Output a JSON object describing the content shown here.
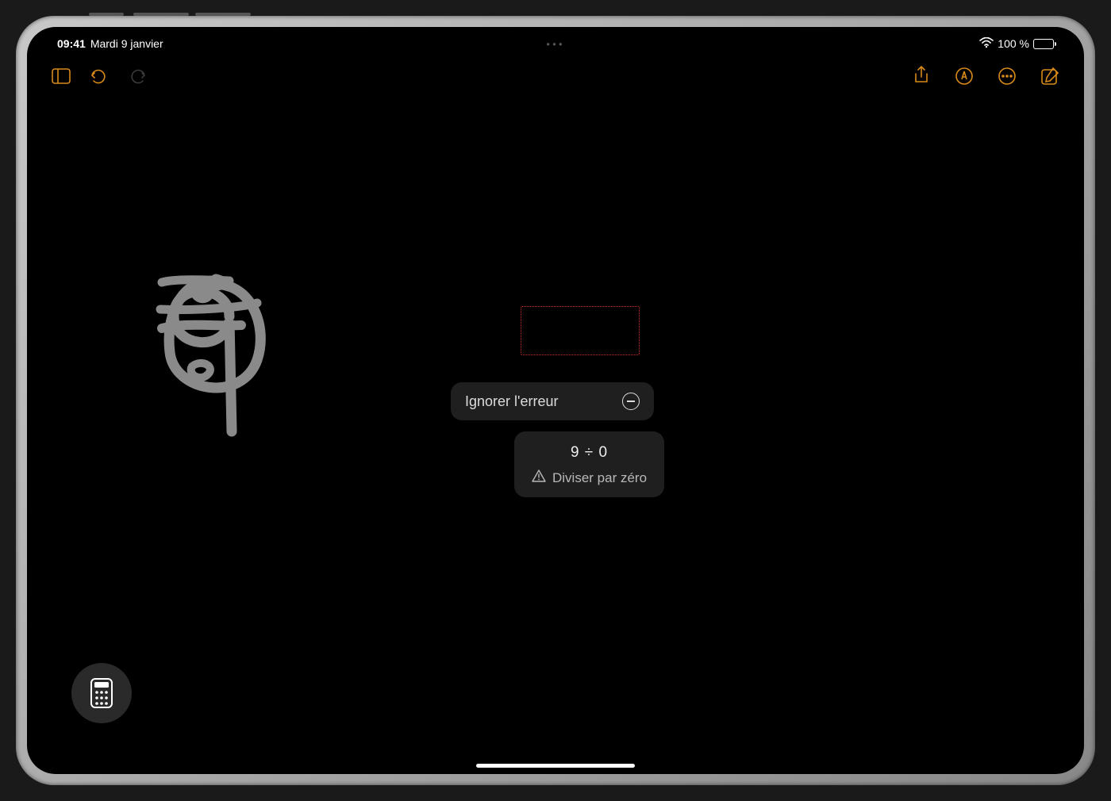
{
  "status": {
    "time": "09:41",
    "date": "Mardi 9 janvier",
    "battery_pct": "100 %"
  },
  "toolbar": {
    "sidebar_icon": "sidebar",
    "undo_icon": "undo",
    "redo_icon": "redo",
    "share_icon": "share",
    "markup_icon": "markup",
    "more_icon": "more",
    "compose_icon": "compose"
  },
  "handwriting": {
    "expression": "9 ÷ 0 ="
  },
  "error": {
    "ignore_label": "Ignorer l'erreur",
    "expression": "9 ÷ 0",
    "message": "Diviser par zéro"
  },
  "colors": {
    "accent": "#d88a1a",
    "error_border": "#d0332a",
    "stroke": "#8a8a8a"
  }
}
